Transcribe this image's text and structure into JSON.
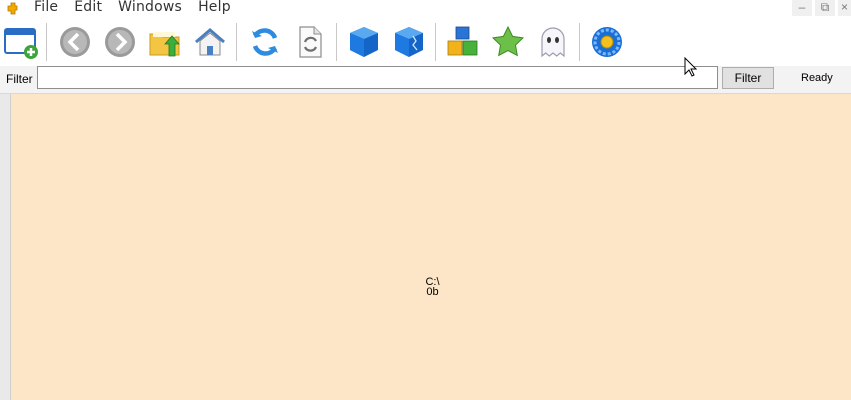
{
  "menubar": {
    "items": [
      "File",
      "Edit",
      "Windows",
      "Help"
    ],
    "controls": [
      "minimize-icon",
      "restore-icon",
      "close-icon"
    ]
  },
  "toolbar": {
    "buttons": [
      {
        "icon": "new-window-icon"
      },
      {
        "icon": "back-arrow-icon"
      },
      {
        "icon": "forward-arrow-icon"
      },
      {
        "icon": "folder-up-icon"
      },
      {
        "icon": "home-icon"
      },
      {
        "icon": "refresh-icon"
      },
      {
        "icon": "document-refresh-icon"
      },
      {
        "icon": "blue-cube-icon"
      },
      {
        "icon": "blue-cube-cracked-icon"
      },
      {
        "icon": "colored-blocks-icon"
      },
      {
        "icon": "green-star-icon"
      },
      {
        "icon": "ghost-icon"
      },
      {
        "icon": "blue-flower-icon"
      }
    ]
  },
  "filter": {
    "label": "Filter",
    "value": "",
    "button_label": "Filter"
  },
  "status": "Ready",
  "main": {
    "path": "C:\\",
    "size": "0b"
  },
  "colors": {
    "main_background": "#fde6c8",
    "accent_blue": "#1e6fd9"
  }
}
